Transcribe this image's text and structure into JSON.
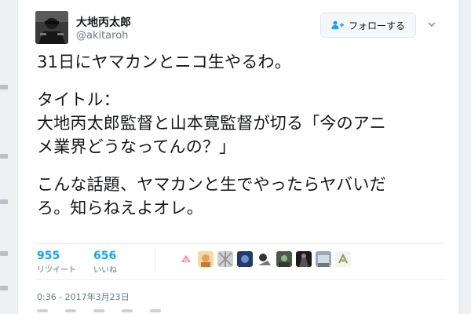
{
  "user": {
    "display_name": "大地丙太郎",
    "handle": "@akitaroh"
  },
  "follow_button": {
    "label": "フォローする",
    "icon": "person-add-icon"
  },
  "tweet": {
    "line1": "31日にヤマカンとニコ生やるわ。",
    "line2": "タイトル：\n大地丙太郎監督と山本寛監督が切る「今のアニ\nメ業界どうなってんの？」",
    "line3": "こんな話題、ヤマカンと生でやったらヤバいだ\nろ。知らねえよオレ。"
  },
  "stats": {
    "retweets": {
      "count": "955",
      "label": "リツイート"
    },
    "likes": {
      "count": "656",
      "label": "いいね"
    }
  },
  "timestamp": "0:36 - 2017年3月23日",
  "colors": {
    "accent": "#1da1f2",
    "text": "#14171a",
    "muted": "#657786"
  },
  "liker_avatars": [
    "avatar-1",
    "avatar-2",
    "avatar-3",
    "avatar-4",
    "avatar-5",
    "avatar-6",
    "avatar-7",
    "avatar-8",
    "avatar-9"
  ]
}
